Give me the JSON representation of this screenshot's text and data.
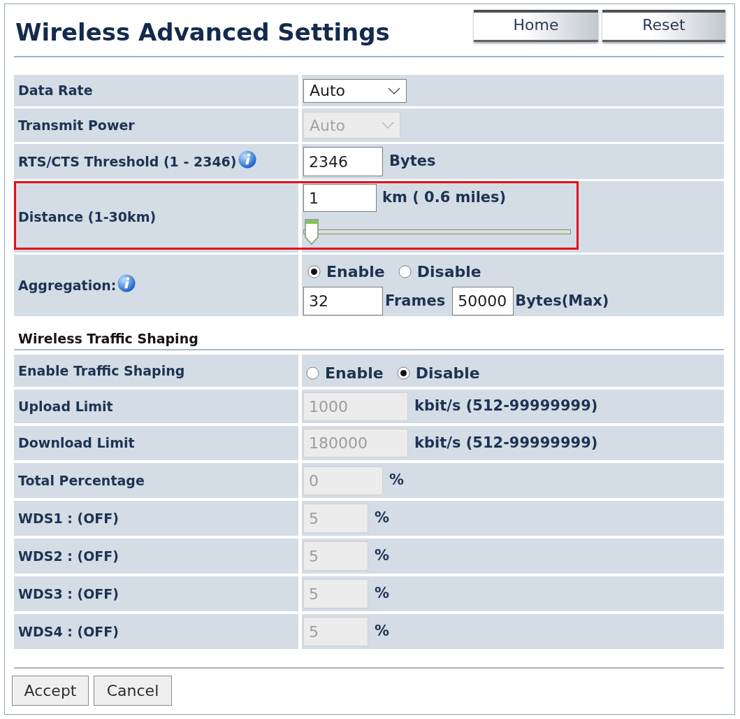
{
  "title": "Wireless Advanced Settings",
  "header_buttons": [
    {
      "label": "Home"
    },
    {
      "label": "Reset"
    }
  ],
  "settings": [
    {
      "kind": "select",
      "label": "Data Rate",
      "value": "Auto",
      "disabled": false
    },
    {
      "kind": "select",
      "label": "Transmit Power",
      "value": "Auto",
      "disabled": true
    },
    {
      "kind": "input",
      "label": "RTS/CTS Threshold (1 - 2346)",
      "info": true,
      "value": "2346",
      "unit": "Bytes",
      "disabled": false
    },
    {
      "kind": "slider",
      "label": "Distance (1-30km)",
      "highlighted": true,
      "value": "1",
      "unit": "km ( 0.6 miles)",
      "level": 0
    },
    {
      "kind": "aggregation",
      "label": "Aggregation:",
      "info": true,
      "options": [
        {
          "label": "Enable",
          "selected": true
        },
        {
          "label": "Disable",
          "selected": false
        }
      ],
      "frames": "32",
      "frames_unit": "Frames",
      "bytes": "50000",
      "bytes_unit": "Bytes(Max)"
    }
  ],
  "traffic_shaping": {
    "heading": "Wireless Traffic Shaping",
    "settings": [
      {
        "kind": "radio",
        "label": "Enable Traffic Shaping",
        "options": [
          {
            "label": "Enable",
            "selected": false
          },
          {
            "label": "Disable",
            "selected": true
          }
        ]
      },
      {
        "kind": "input",
        "label": "Upload Limit",
        "value": "1000",
        "unit": "kbit/s (512-99999999)",
        "disabled": true
      },
      {
        "kind": "input",
        "label": "Download Limit",
        "value": "180000",
        "unit": "kbit/s (512-99999999)",
        "disabled": true
      },
      {
        "kind": "input",
        "label": "Total Percentage",
        "value": "0",
        "unit": "%",
        "disabled": true
      },
      {
        "kind": "input",
        "label": "WDS1 : (OFF)",
        "value": "5",
        "unit": "%",
        "disabled": true
      },
      {
        "kind": "input",
        "label": "WDS2 : (OFF)",
        "value": "5",
        "unit": "%",
        "disabled": true
      },
      {
        "kind": "input",
        "label": "WDS3 : (OFF)",
        "value": "5",
        "unit": "%",
        "disabled": true
      },
      {
        "kind": "input",
        "label": "WDS4 : (OFF)",
        "value": "5",
        "unit": "%",
        "disabled": true
      }
    ]
  },
  "footer_buttons": [
    {
      "label": "Accept"
    },
    {
      "label": "Cancel"
    }
  ]
}
